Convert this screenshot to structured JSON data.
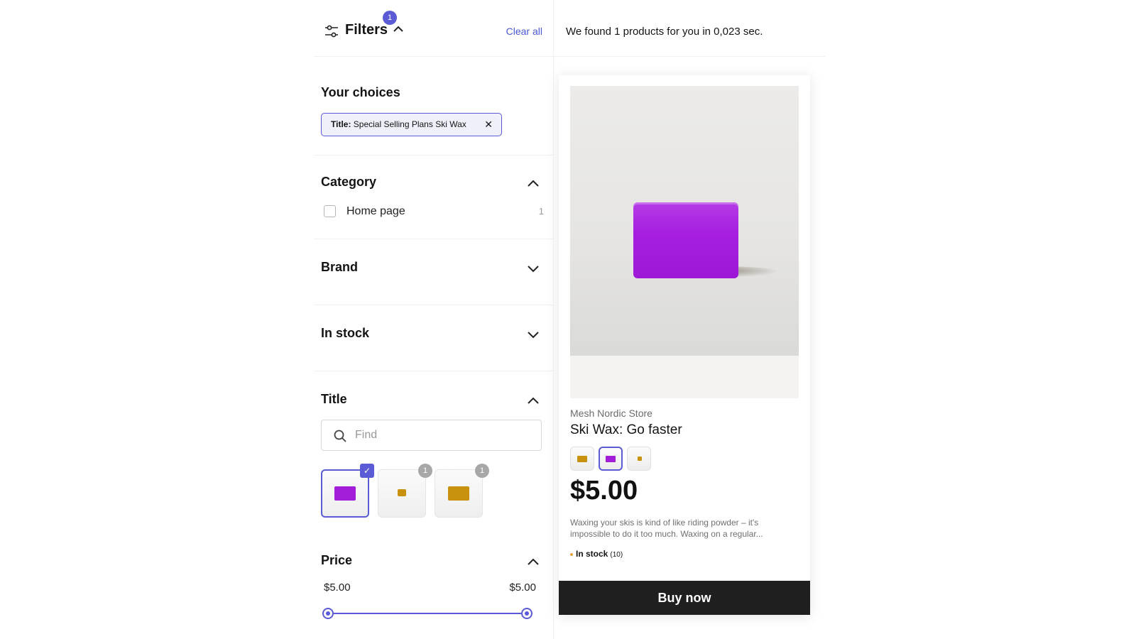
{
  "filters": {
    "title": "Filters",
    "badge": "1",
    "clear_all": "Clear all"
  },
  "choices": {
    "title": "Your choices",
    "chip_key": "Title:",
    "chip_value": " Special Selling Plans Ski Wax",
    "chip_remove": "✕"
  },
  "category": {
    "title": "Category",
    "options": [
      {
        "label": "Home page",
        "count": "1",
        "checked": false
      }
    ]
  },
  "brand": {
    "title": "Brand",
    "expanded": false
  },
  "in_stock": {
    "title": "In stock",
    "expanded": false
  },
  "title_filter": {
    "title": "Title",
    "search_placeholder": "Find",
    "options": [
      {
        "color": "#a31ed9",
        "selected": true,
        "check": "✓"
      },
      {
        "color": "#c9920e",
        "selected": false,
        "count": "1"
      },
      {
        "color": "#c9920e",
        "selected": false,
        "count": "1"
      }
    ]
  },
  "price": {
    "title": "Price",
    "min_label": "$5.00",
    "max_label": "$5.00"
  },
  "results": {
    "summary": "We found 1 products for you in 0,023 sec."
  },
  "product": {
    "vendor": "Mesh Nordic Store",
    "title": "Ski Wax: Go faster",
    "price": "$5.00",
    "description": "Waxing your skis is kind of like riding powder – it's impossible to do it too much. Waxing on a regular...",
    "stock_label": "In stock",
    "stock_count": "(10)",
    "buy_label": "Buy now",
    "swatches": [
      {
        "color": "#c9920e",
        "selected": false
      },
      {
        "color": "#a31ed9",
        "selected": true
      },
      {
        "color": "#c9920e",
        "selected": false
      }
    ]
  },
  "colors": {
    "accent": "#5b5bd6",
    "wax_purple": "#a31ed9",
    "wax_gold": "#c9920e",
    "buy_button": "#1f1f1f"
  },
  "icons": [
    "sliders-icon",
    "chevron-up-icon",
    "chevron-down-icon",
    "close-icon",
    "search-icon",
    "check-icon"
  ]
}
